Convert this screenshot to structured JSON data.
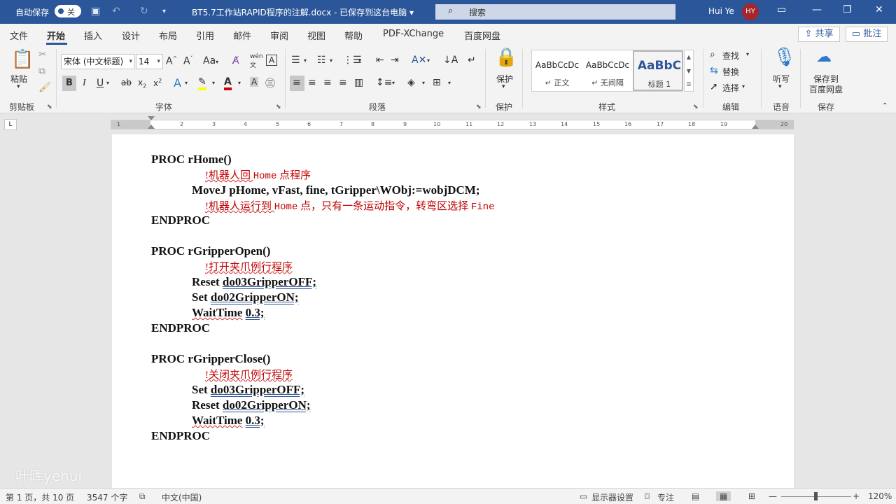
{
  "titlebar": {
    "autosave_label": "自动保存",
    "autosave_state": "关",
    "document_title": "BT5.7工作站RAPID程序的注解.docx - 已保存到这台电脑 ▾",
    "search_placeholder": "搜索",
    "user_name": "Hui Ye",
    "user_initials": "HY",
    "avatar_color": "#a4262c",
    "accent_color": "#2b579a"
  },
  "tabs": [
    "文件",
    "开始",
    "插入",
    "设计",
    "布局",
    "引用",
    "邮件",
    "审阅",
    "视图",
    "帮助",
    "PDF-XChange",
    "百度网盘"
  ],
  "share_label": "共享",
  "comment_label": "批注",
  "ribbon": {
    "clipboard": {
      "paste": "粘贴",
      "group": "剪贴板"
    },
    "font": {
      "name": "宋体 (中文标题)",
      "size": "14",
      "group": "字体"
    },
    "paragraph": {
      "group": "段落"
    },
    "protect": {
      "label": "保护",
      "group": "保护"
    },
    "styles": {
      "group": "样式",
      "items": [
        {
          "preview": "AaBbCcDc",
          "name": "↵ 正文"
        },
        {
          "preview": "AaBbCcDc",
          "name": "↵ 无间隔"
        },
        {
          "preview": "AaBbC",
          "name": "标题 1"
        }
      ]
    },
    "editing": {
      "find": "查找",
      "replace": "替换",
      "select": "选择",
      "group": "编辑"
    },
    "voice": {
      "dictate": "听写",
      "group": "语音"
    },
    "save": {
      "label1": "保存到",
      "label2": "百度网盘",
      "group": "保存"
    }
  },
  "ruler_numbers": [
    "1",
    "1",
    "2",
    "3",
    "4",
    "5",
    "6",
    "7",
    "8",
    "9",
    "10",
    "11",
    "12",
    "13",
    "14",
    "15",
    "16",
    "17",
    "18",
    "19",
    "20"
  ],
  "document": {
    "lines": [
      "PROC rHome()",
      "!机器人回 ",
      "Home",
      " 点程序",
      "MoveJ pHome, vFast, fine, tGripper\\WObj:=wobjDCM;",
      "!机器人运行到 ",
      "Home",
      " 点，只有一条运动指令，转弯区选择 ",
      "Fine",
      "ENDPROC",
      "PROC rGripperOpen()",
      "!打开夹爪例行程序",
      "Reset ",
      "do03GripperOFF;",
      "Set ",
      "do02GripperON;",
      "WaitTime",
      " ",
      "0.3;",
      "ENDPROC",
      "PROC rGripperClose()",
      "!关闭夹爪例行程序",
      "Set ",
      "do03GripperOFF;",
      "Reset ",
      "do02GripperON;",
      "WaitTime",
      " ",
      "0.3;",
      "ENDPROC"
    ]
  },
  "watermark": "叶晖yehui",
  "status": {
    "page": "第 1 页，共 10 页",
    "words": "3547 个字",
    "language": "中文(中国)",
    "display_settings": "显示器设置",
    "focus": "专注",
    "zoom_minus": "—",
    "zoom_plus": "+",
    "zoom": "120%",
    "zoom_level_percent": 120
  }
}
